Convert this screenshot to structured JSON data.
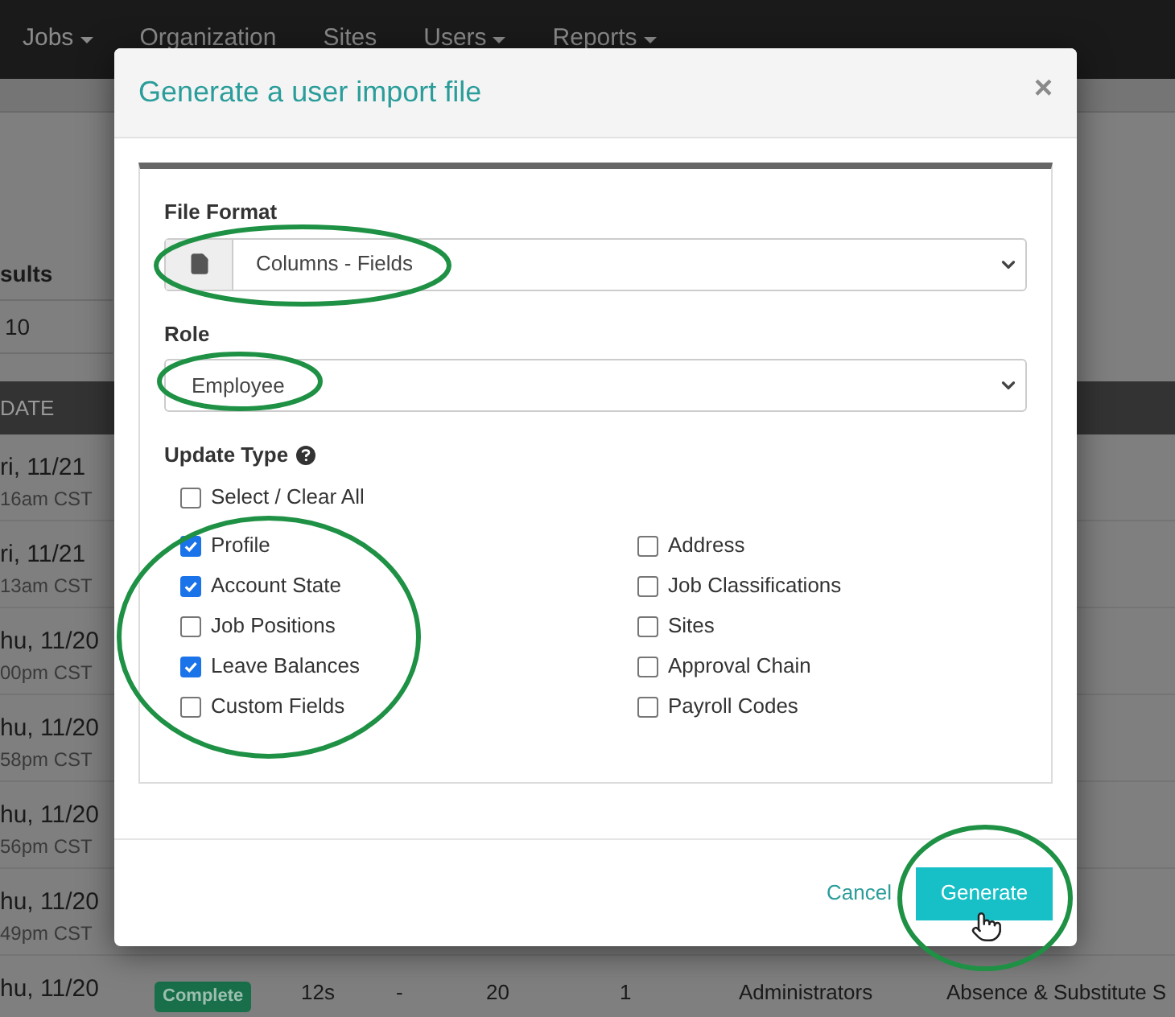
{
  "nav": [
    {
      "label": "Jobs",
      "dropdown": true
    },
    {
      "label": "Organization",
      "dropdown": false
    },
    {
      "label": "Sites",
      "dropdown": false
    },
    {
      "label": "Users",
      "dropdown": true
    },
    {
      "label": "Reports",
      "dropdown": true
    }
  ],
  "results_panel": {
    "heading": "sults",
    "count": "10"
  },
  "table": {
    "column_1": "DATE",
    "rows": [
      {
        "date": "ri, 11/21",
        "time": "16am CST"
      },
      {
        "date": "ri, 11/21",
        "time": "13am CST"
      },
      {
        "date": "hu, 11/20",
        "time": "00pm CST"
      },
      {
        "date": "hu, 11/20",
        "time": "58pm CST"
      },
      {
        "date": "hu, 11/20",
        "time": "56pm CST"
      },
      {
        "date": "hu, 11/20",
        "time": "49pm CST"
      },
      {
        "date": "hu, 11/20",
        "status": "Complete",
        "cells": [
          "12s",
          "-",
          "20",
          "1",
          "Administrators",
          "Absence & Substitute S"
        ]
      }
    ]
  },
  "dialog": {
    "title": "Generate a user import file",
    "close": "×",
    "file_format": {
      "label": "File Format",
      "value": "Columns - Fields"
    },
    "role": {
      "label": "Role",
      "value": "Employee"
    },
    "update_type": {
      "label": "Update Type",
      "select_all": {
        "label": "Select / Clear All",
        "checked": false
      },
      "options_left": [
        {
          "label": "Profile",
          "checked": true
        },
        {
          "label": "Account State",
          "checked": true
        },
        {
          "label": "Job Positions",
          "checked": false
        },
        {
          "label": "Leave Balances",
          "checked": true
        },
        {
          "label": "Custom Fields",
          "checked": false
        }
      ],
      "options_right": [
        {
          "label": "Address",
          "checked": false
        },
        {
          "label": "Job Classifications",
          "checked": false
        },
        {
          "label": "Sites",
          "checked": false
        },
        {
          "label": "Approval Chain",
          "checked": false
        },
        {
          "label": "Payroll Codes",
          "checked": false
        }
      ]
    },
    "buttons": {
      "cancel": "Cancel",
      "generate": "Generate"
    }
  }
}
